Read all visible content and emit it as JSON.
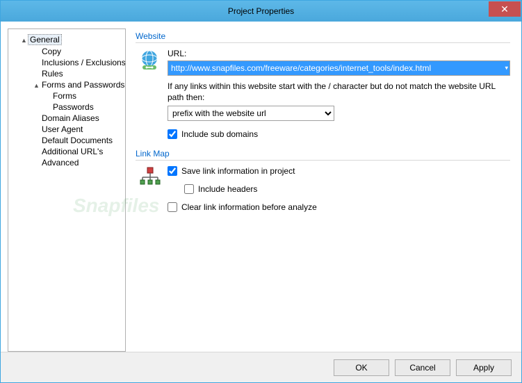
{
  "window": {
    "title": "Project Properties"
  },
  "tree": {
    "items": [
      {
        "label": "General",
        "level": 1,
        "caret": "▲",
        "selected": true
      },
      {
        "label": "Copy",
        "level": 2
      },
      {
        "label": "Inclusions / Exclusions",
        "level": 2
      },
      {
        "label": "Rules",
        "level": 2
      },
      {
        "label": "Forms and Passwords",
        "level": 2,
        "caret": "▲"
      },
      {
        "label": "Forms",
        "level": 3
      },
      {
        "label": "Passwords",
        "level": 3
      },
      {
        "label": "Domain Aliases",
        "level": 2
      },
      {
        "label": "User Agent",
        "level": 2
      },
      {
        "label": "Default Documents",
        "level": 2
      },
      {
        "label": "Additional URL's",
        "level": 2
      },
      {
        "label": "Advanced",
        "level": 2
      }
    ]
  },
  "website": {
    "section_title": "Website",
    "url_label": "URL:",
    "url_value": "http://www.snapfiles.com/freeware/categories/internet_tools/index.html",
    "prefix_desc": "If any links within this website start with the / character but do not match the website URL path then:",
    "prefix_select_value": "prefix with the website url",
    "include_subdomains_label": "Include sub domains",
    "include_subdomains_checked": true
  },
  "linkmap": {
    "section_title": "Link Map",
    "save_info_label": "Save link information in project",
    "save_info_checked": true,
    "include_headers_label": "Include headers",
    "include_headers_checked": false,
    "clear_info_label": "Clear link information before analyze",
    "clear_info_checked": false
  },
  "buttons": {
    "ok": "OK",
    "cancel": "Cancel",
    "apply": "Apply"
  },
  "watermark": "Snapfiles"
}
